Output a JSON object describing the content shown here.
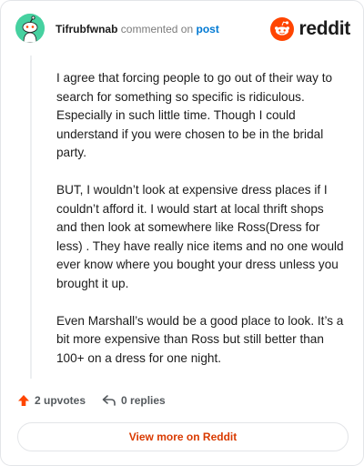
{
  "header": {
    "username": "Tifrubfwnab",
    "action_text": "commented on",
    "post_link": "post",
    "brand": "reddit"
  },
  "comment": {
    "paragraphs": [
      "I agree that forcing people to go out of their way to search for something so specific is ridiculous. Especially in such little time. Though I could understand if you were chosen to be in the bridal party.",
      "BUT, I wouldn’t look at expensive dress places if I couldn’t afford it. I would start at local thrift shops and then look at somewhere like Ross(Dress for less) . They have really nice items and no one would ever know where you bought your dress unless you brought it up.",
      "Even Marshall’s would be a good place to look. It’s a bit more expensive than Ross but still better than 100+ on a dress for one night."
    ]
  },
  "footer": {
    "upvotes": "2 upvotes",
    "replies": "0 replies",
    "view_more": "View more on Reddit"
  },
  "colors": {
    "accent": "#ff4500",
    "link": "#0079d3",
    "avatar": "#46d1a0"
  },
  "icons": {
    "avatar": "snoo-avatar-icon",
    "logo": "reddit-logo-icon",
    "upvote": "upvote-arrow-icon",
    "reply": "reply-arrow-icon"
  }
}
